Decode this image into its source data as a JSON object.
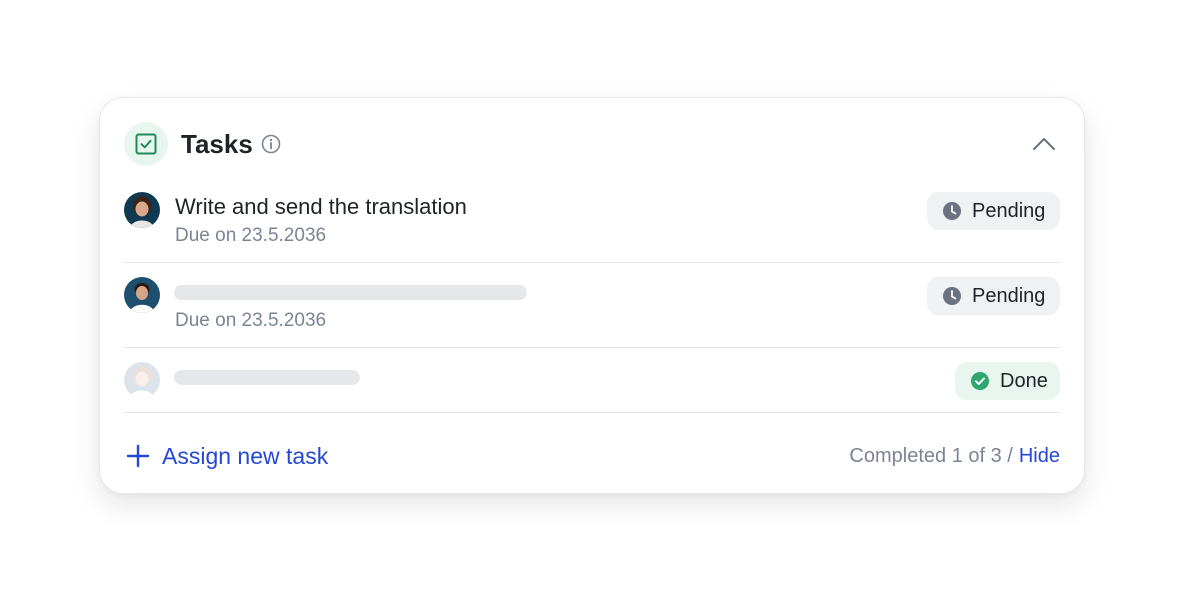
{
  "header": {
    "title": "Tasks",
    "icon": "checkbox-icon",
    "info_icon": "info-icon",
    "collapse_icon": "chevron-up-icon"
  },
  "tasks": [
    {
      "title": "Write and send the translation",
      "due": "Due on 23.5.2036",
      "status": "Pending",
      "status_icon": "clock-icon"
    },
    {
      "due": "Due on 23.5.2036",
      "status": "Pending",
      "status_icon": "clock-icon"
    },
    {
      "status": "Done",
      "status_icon": "check-circle-icon"
    }
  ],
  "footer": {
    "assign_label": "Assign new task",
    "progress_label": "Completed 1 of 3 /",
    "hide_label": "Hide"
  },
  "colors": {
    "accent_blue": "#2447d6",
    "success_green": "#2fa56f",
    "success_bg": "#e9f6ef",
    "pending_bg": "#f0f1f3",
    "muted_text": "#7b8494",
    "text": "#1f2328"
  }
}
